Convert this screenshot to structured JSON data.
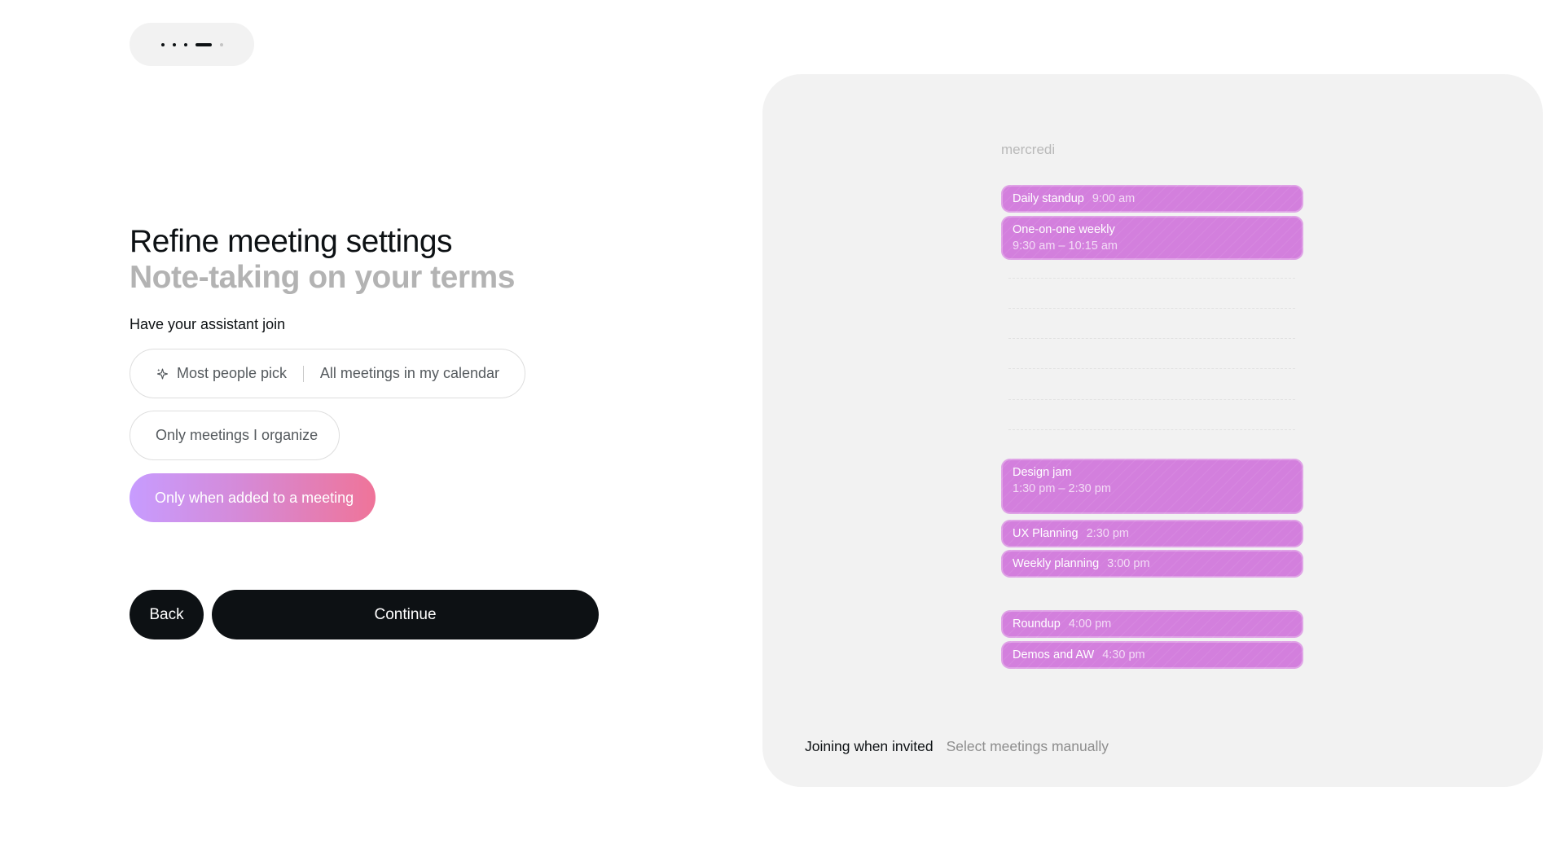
{
  "progress": {
    "steps_total": 5,
    "current_step": 4
  },
  "header": {
    "title": "Refine meeting settings",
    "subtitle": "Note-taking on your terms"
  },
  "join": {
    "label": "Have your assistant join",
    "options": [
      {
        "badge": "Most people pick",
        "label": "All meetings in my calendar",
        "selected": false
      },
      {
        "label": "Only meetings I organize",
        "selected": false
      },
      {
        "label": "Only when added to a meeting",
        "selected": true
      }
    ]
  },
  "actions": {
    "back_label": "Back",
    "continue_label": "Continue"
  },
  "preview": {
    "day": "mercredi",
    "event_color": "#d37fdd",
    "events": [
      {
        "name": "Daily standup",
        "time": "9:00 am"
      },
      {
        "name": "One-on-one weekly",
        "time": "9:30 am – 10:15 am"
      },
      {
        "name": "Design jam",
        "time": "1:30 pm – 2:30 pm"
      },
      {
        "name": "UX Planning",
        "time": "2:30 pm"
      },
      {
        "name": "Weekly planning",
        "time": "3:00 pm"
      },
      {
        "name": "Roundup",
        "time": "4:00 pm"
      },
      {
        "name": "Demos and AW",
        "time": "4:30 pm"
      }
    ],
    "status_active": "Joining when invited",
    "status_inactive": "Select meetings manually"
  },
  "colors": {
    "accent_gradient_start": "#c79cff",
    "accent_gradient_end": "#ef7499",
    "button_dark": "#0d1114"
  }
}
